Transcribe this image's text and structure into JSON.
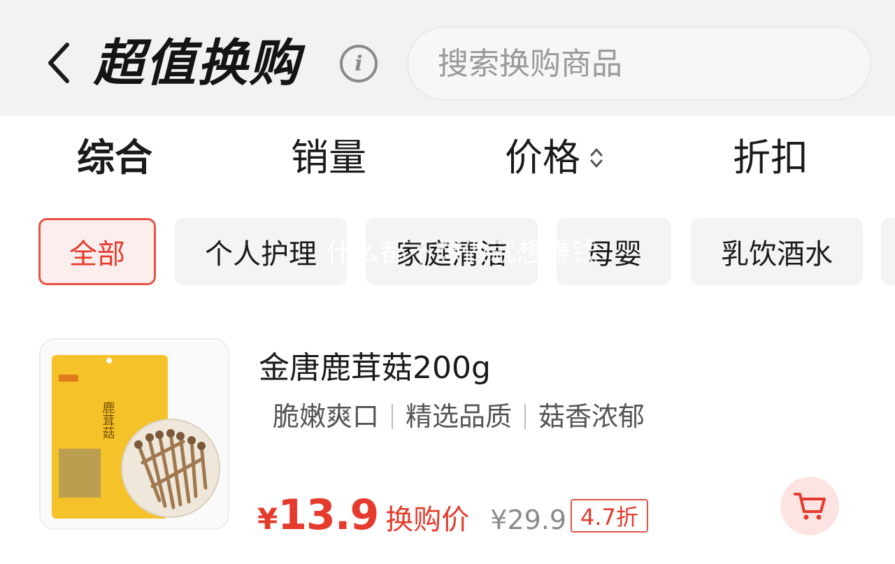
{
  "header": {
    "title": "超值换购",
    "search_placeholder": "搜索换购商品"
  },
  "sort_tabs": [
    {
      "label": "综合",
      "active": true
    },
    {
      "label": "销量",
      "active": false
    },
    {
      "label": "价格",
      "active": false
    },
    {
      "label": "折扣",
      "active": false
    }
  ],
  "categories": [
    {
      "label": "全部",
      "active": true
    },
    {
      "label": "个人护理",
      "active": false
    },
    {
      "label": "家庭清洁",
      "active": false
    },
    {
      "label": "母婴",
      "active": false
    },
    {
      "label": "乳饮酒水",
      "active": false
    }
  ],
  "watermark": "什么都不想做就想赚钱",
  "product": {
    "name": "金唐鹿茸菇200g",
    "tags": [
      "脆嫩爽口",
      "精选品质",
      "菇香浓郁"
    ],
    "currency": "¥",
    "price": "13.9",
    "price_label": "换购价",
    "original_price": "¥29.9",
    "discount": "4.7折",
    "package_title": "鹿茸菇"
  },
  "colors": {
    "accent_red": "#e53b2c",
    "header_bg": "#f2f2f2",
    "chip_bg": "#f4f4f4",
    "package_yellow": "#f6c22a"
  }
}
